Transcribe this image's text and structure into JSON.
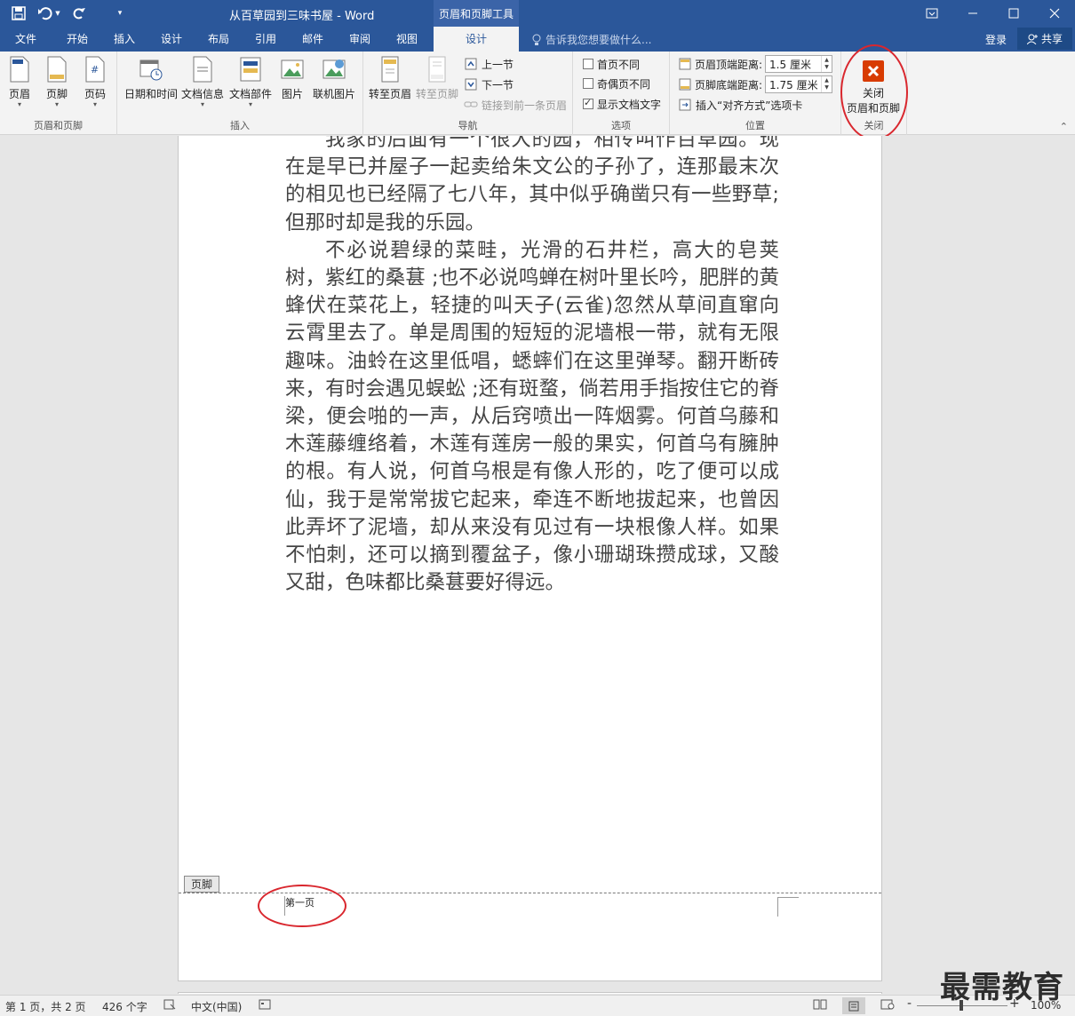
{
  "window": {
    "title": "从百草园到三味书屋 - Word",
    "context_tab_group": "页眉和页脚工具"
  },
  "qat": {
    "save_icon": "save-icon",
    "undo_icon": "undo-icon",
    "redo_icon": "redo-icon",
    "customize_icon": "customize-qat-icon"
  },
  "tabs": [
    {
      "label": "文件"
    },
    {
      "label": "开始"
    },
    {
      "label": "插入"
    },
    {
      "label": "设计"
    },
    {
      "label": "布局"
    },
    {
      "label": "引用"
    },
    {
      "label": "邮件"
    },
    {
      "label": "审阅"
    },
    {
      "label": "视图"
    },
    {
      "label": "设计"
    }
  ],
  "tellme": "告诉我您想要做什么...",
  "login": "登录",
  "share": "共享",
  "ribbon": {
    "group_hf": {
      "label": "页眉和页脚",
      "header": "页眉",
      "footer": "页脚",
      "page_number": "页码"
    },
    "group_insert": {
      "label": "插入",
      "datetime": "日期和时间",
      "docinfo": "文档信息",
      "quickparts": "文档部件",
      "picture": "图片",
      "online_picture": "联机图片"
    },
    "group_nav": {
      "label": "导航",
      "goto_header": "转至页眉",
      "goto_footer": "转至页脚",
      "previous": "上一节",
      "next": "下一节",
      "link_previous": "链接到前一条页眉"
    },
    "group_options": {
      "label": "选项",
      "different_first": "首页不同",
      "different_odd_even": "奇偶页不同",
      "show_doc_text": "显示文档文字",
      "different_first_checked": false,
      "different_odd_even_checked": false,
      "show_doc_text_checked": true
    },
    "group_position": {
      "label": "位置",
      "header_top_label": "页眉顶端距离:",
      "header_top_value": "1.5 厘米",
      "footer_bottom_label": "页脚底端距离:",
      "footer_bottom_value": "1.75 厘米",
      "insert_align_tab": "插入“对齐方式”选项卡"
    },
    "group_close": {
      "label": "关闭",
      "close_line1": "关闭",
      "close_line2": "页眉和页脚"
    }
  },
  "document": {
    "paragraphs": [
      "我家的后面有一个很大的园，相传叫作百草园。现在是早已并屋子一起卖给朱文公的子孙了，连那最末次的相见也已经隔了七八年，其中似乎确凿只有一些野草;但那时却是我的乐园。",
      "不必说碧绿的菜畦，光滑的石井栏，高大的皂荚树，紫红的桑葚 ;也不必说鸣蝉在树叶里长吟，肥胖的黄蜂伏在菜花上，轻捷的叫天子(云雀)忽然从草间直窜向云霄里去了。单是周围的短短的泥墙根一带，就有无限趣味。油蛉在这里低唱，蟋蟀们在这里弹琴。翻开断砖来，有时会遇见蜈蚣 ;还有斑蝥，倘若用手指按住它的脊梁，便会啪的一声，从后窍喷出一阵烟雾。何首乌藤和木莲藤缠络着，木莲有莲房一般的果实，何首乌有臃肿的根。有人说，何首乌根是有像人形的，吃了便可以成仙，我于是常常拔它起来，牵连不断地拔起来，也曾因此弄坏了泥墙，却从来没有见过有一块根像人样。如果不怕刺，还可以摘到覆盆子，像小珊瑚珠攒成球，又酸又甜，色味都比桑葚要好得远。"
    ],
    "footer_tag": "页脚",
    "footer_text": "第一页"
  },
  "status": {
    "page": "第 1 页，共 2 页",
    "words": "426 个字",
    "language": "中文(中国)",
    "zoom": "100%",
    "zoom_minus": "-",
    "zoom_plus": "+"
  },
  "watermark": "最需教育",
  "colors": {
    "accent": "#2b579a",
    "annotation": "#d9272e",
    "close_button": "#d83b01"
  }
}
